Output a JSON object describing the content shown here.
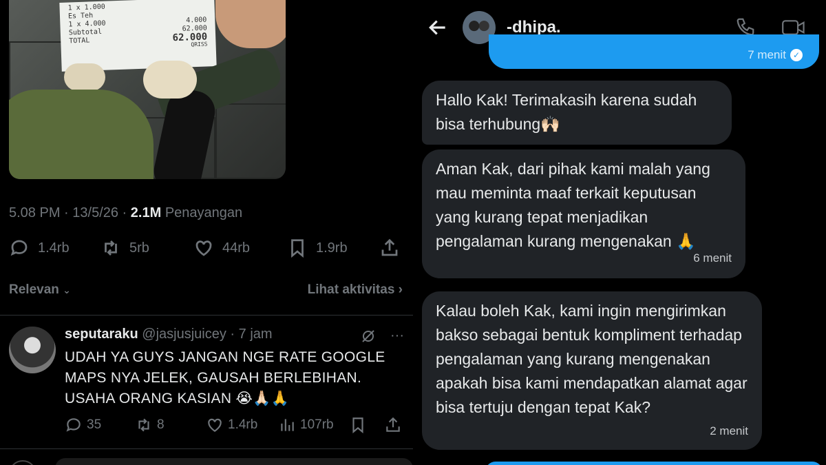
{
  "tweet": {
    "receipt": {
      "item_line1": "1 x 1.000",
      "item_name": "Es Teh",
      "item_qty": "1 x 4.000",
      "item_price": "4.000",
      "subtotal_label": "Subtotal",
      "subtotal_value": "62.000",
      "total_label": "TOTAL",
      "total_value": "62.000",
      "payment": "QRISS"
    },
    "time": "5.08 PM",
    "date": "13/5/26",
    "views_count": "2.1M",
    "views_label": "Penayangan",
    "actions": {
      "replies": "1.4rb",
      "retweets": "5rb",
      "likes": "44rb",
      "bookmarks": "1.9rb"
    },
    "sort_label": "Relevan",
    "activity_label": "Lihat aktivitas"
  },
  "reply": {
    "name": "seputaraku",
    "handle": "@jasjusjuicey",
    "age": "7 jam",
    "text": "UDAH YA GUYS JANGAN NGE RATE GOOGLE MAPS NYA JELEK, GAUSAH BERLEBIHAN. USAHA ORANG KASIAN 😭🙏🏻🙏",
    "replies": "35",
    "retweets": "8",
    "likes": "1.4rb",
    "views": "107rb"
  },
  "chat": {
    "contact_name": "-dhipa.",
    "sent_time": "7 menit",
    "messages": [
      {
        "text": "Hallo Kak! Terimakasih karena sudah bisa terhubung🙌🏻",
        "time": ""
      },
      {
        "text": "Aman Kak, dari pihak kami malah yang mau meminta maaf terkait keputusan yang kurang tepat menjadikan pengalaman kurang mengenakan 🙏",
        "time": "6 menit"
      },
      {
        "text": "Kalau boleh Kak, kami ingin mengirimkan bakso sebagai bentuk kompliment terhadap pengalaman yang kurang mengenakan apakah bisa kami mendapatkan alamat agar bisa tertuju dengan tepat Kak?",
        "time": "2 menit"
      }
    ]
  },
  "colors": {
    "background": "#000000",
    "accent": "#1d9bf0",
    "muted": "#71767b",
    "bubble": "#202327"
  }
}
